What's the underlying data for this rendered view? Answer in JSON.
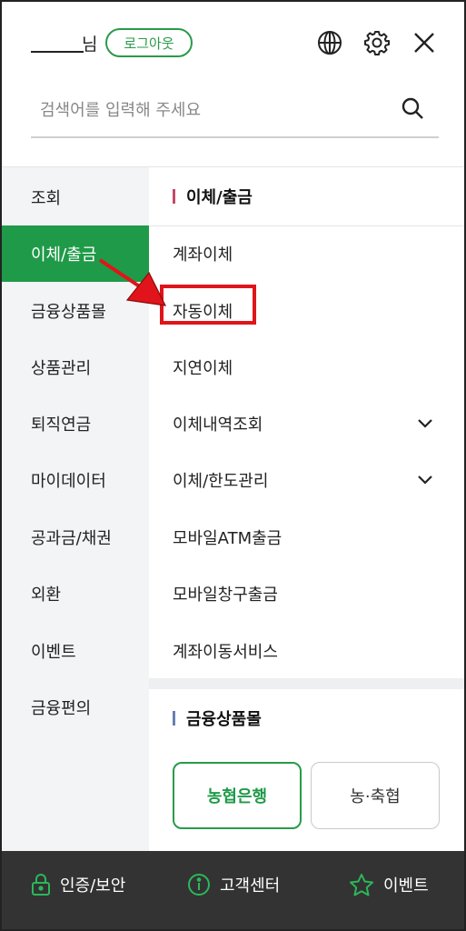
{
  "header": {
    "user_suffix": "님",
    "logout_label": "로그아웃",
    "search_placeholder": "검색어를 입력해 주세요"
  },
  "sidebar": {
    "items": [
      {
        "label": "조회"
      },
      {
        "label": "이체/출금",
        "active": true
      },
      {
        "label": "금융상품몰"
      },
      {
        "label": "상품관리"
      },
      {
        "label": "퇴직연금"
      },
      {
        "label": "마이데이터"
      },
      {
        "label": "공과금/채권"
      },
      {
        "label": "외환"
      },
      {
        "label": "이벤트"
      },
      {
        "label": "금융편의"
      }
    ]
  },
  "content": {
    "section1_title": "이체/출금",
    "section1_items": [
      {
        "label": "계좌이체"
      },
      {
        "label": "자동이체",
        "highlighted": true
      },
      {
        "label": "지연이체"
      },
      {
        "label": "이체내역조회",
        "expandable": true
      },
      {
        "label": "이체/한도관리",
        "expandable": true
      },
      {
        "label": "모바일ATM출금"
      },
      {
        "label": "모바일창구출금"
      },
      {
        "label": "계좌이동서비스"
      }
    ],
    "section2_title": "금융상품몰",
    "bank_buttons": [
      {
        "label": "농협은행",
        "selected": true
      },
      {
        "label": "농·축협",
        "selected": false
      }
    ]
  },
  "footer": {
    "items": [
      {
        "label": "인증/보안",
        "icon": "lock-icon"
      },
      {
        "label": "고객센터",
        "icon": "info-icon"
      },
      {
        "label": "이벤트",
        "icon": "star-icon"
      }
    ]
  },
  "colors": {
    "accent_green": "#1f9a48",
    "highlight_red": "#e0141a",
    "footer_bg": "#333333"
  }
}
